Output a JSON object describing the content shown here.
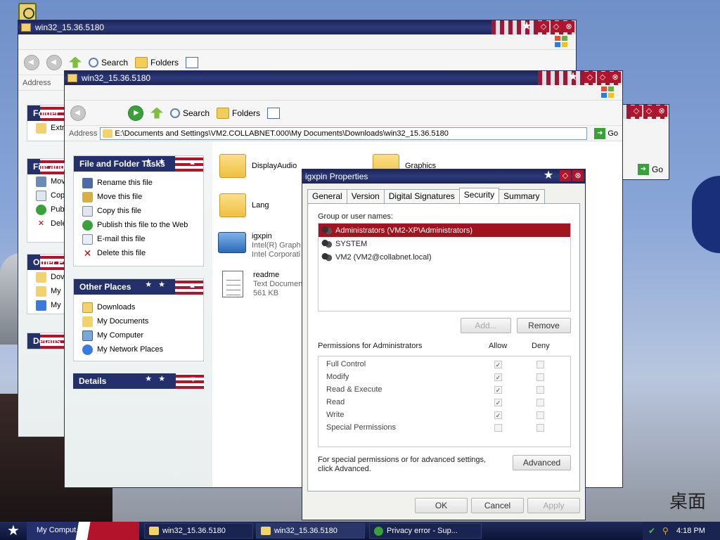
{
  "window_back": {
    "title": "win32_15.36.5180",
    "search": "Search",
    "folders": "Folders",
    "address_label": "Address",
    "panels": {
      "folder": "Folder",
      "file_and": "File and",
      "other": "Other P",
      "details": "Details"
    },
    "tasks": [
      "Extr",
      "Mov",
      "Cop",
      "Pub",
      "Dele"
    ],
    "other_items": [
      "Dov",
      "My",
      "My"
    ]
  },
  "window_right": {
    "go": "Go"
  },
  "window_main": {
    "title": "win32_15.36.5180",
    "toolbar": {
      "search": "Search",
      "folders": "Folders"
    },
    "address_label": "Address",
    "address_value": "E:\\Documents and Settings\\VM2.COLLABNET.000\\My Documents\\Downloads\\win32_15.36.5180",
    "go": "Go",
    "panels": {
      "file_tasks": {
        "title": "File and Folder Tasks",
        "items": [
          "Rename this file",
          "Move this file",
          "Copy this file",
          "Publish this file to the Web",
          "E-mail this file",
          "Delete this file"
        ]
      },
      "other_places": {
        "title": "Other Places",
        "items": [
          "Downloads",
          "My Documents",
          "My Computer",
          "My Network Places"
        ]
      },
      "details": {
        "title": "Details"
      }
    },
    "files": [
      {
        "name": "DisplayAudio"
      },
      {
        "name": "Graphics"
      },
      {
        "name": "Lang"
      },
      {
        "name": "igxpin",
        "line2": "Intel(R) Graph",
        "line3": "Intel Corporati"
      },
      {
        "name": "readme",
        "line2": "Text Documen",
        "line3": "561 KB"
      }
    ]
  },
  "dialog": {
    "title": "igxpin Properties",
    "tabs": [
      "General",
      "Version",
      "Digital Signatures",
      "Security",
      "Summary"
    ],
    "group_label": "Group or user names:",
    "users": [
      "Administrators (VM2-XP\\Administrators)",
      "SYSTEM",
      "VM2 (VM2@collabnet.local)"
    ],
    "add": "Add...",
    "remove": "Remove",
    "perm_label": "Permissions for Administrators",
    "allow": "Allow",
    "deny": "Deny",
    "permissions": [
      {
        "name": "Full Control",
        "allow": "✓"
      },
      {
        "name": "Modify",
        "allow": "✓"
      },
      {
        "name": "Read & Execute",
        "allow": "✓"
      },
      {
        "name": "Read",
        "allow": "✓"
      },
      {
        "name": "Write",
        "allow": "✓"
      },
      {
        "name": "Special Permissions",
        "allow": ""
      }
    ],
    "special_text_1": "For special permissions or for advanced settings,",
    "special_text_2": "click Advanced.",
    "advanced": "Advanced",
    "ok": "OK",
    "cancel": "Cancel",
    "apply": "Apply"
  },
  "taskbar": {
    "items": [
      "win32_15.36.5180",
      "win32_15.36.5180",
      "Privacy error - Sup..."
    ],
    "left_item": "My Comput...",
    "time": "4:18 PM"
  },
  "brand": {
    "logo_text": "桌面"
  }
}
